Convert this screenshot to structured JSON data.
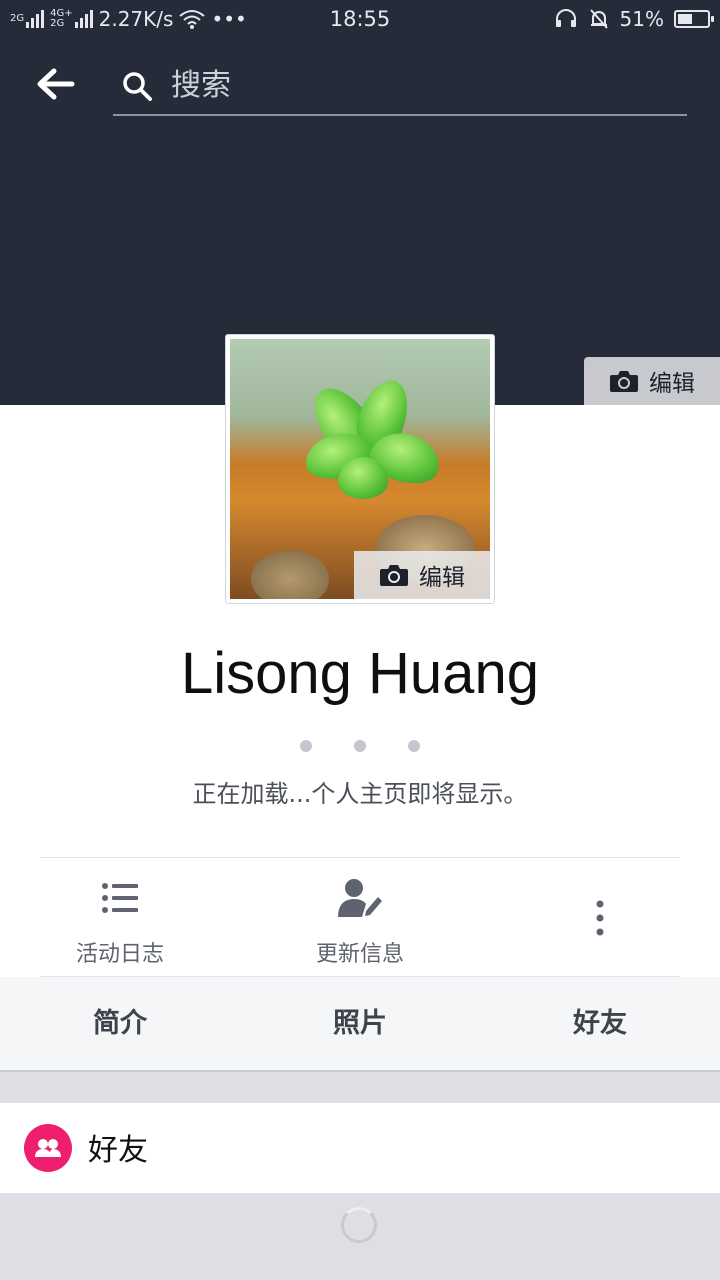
{
  "status_bar": {
    "network_top": "2G",
    "network_bottom_a": "4G+",
    "network_bottom_b": "2G",
    "speed": "2.27K/s",
    "more": "•••",
    "time": "18:55",
    "battery": "51%",
    "battery_level": 0.51
  },
  "header": {
    "search_placeholder": "搜索",
    "cover_edit_label": "编辑"
  },
  "profile": {
    "avatar_edit_label": "编辑",
    "name": "Lisong Huang",
    "loading_text": "正在加载...个人主页即将显示。"
  },
  "actions": [
    {
      "label": "活动日志",
      "icon": "list-icon"
    },
    {
      "label": "更新信息",
      "icon": "edit-person-icon"
    },
    {
      "label": "",
      "icon": "more-vertical-icon"
    }
  ],
  "tabs": [
    {
      "label": "简介"
    },
    {
      "label": "照片"
    },
    {
      "label": "好友"
    }
  ],
  "friends_section": {
    "title": "好友",
    "icon": "friends-icon",
    "icon_color": "#ef1f6f"
  },
  "colors": {
    "cover": "#262b39",
    "accent_pink": "#ef1f6f"
  }
}
